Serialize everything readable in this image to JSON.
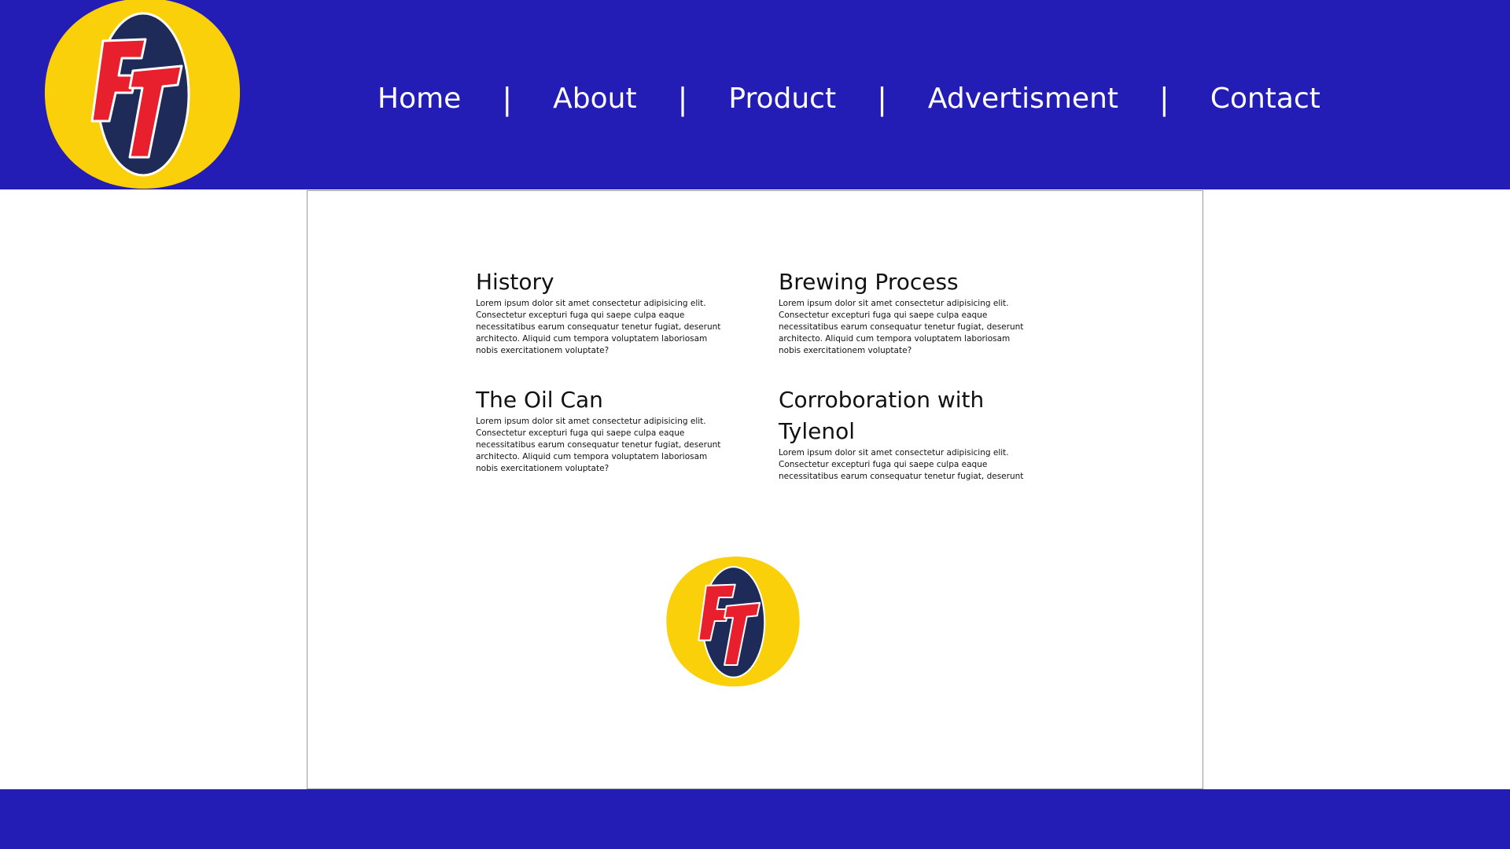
{
  "brand": {
    "logo_letters": "FT",
    "colors": {
      "header_blue": "#231db5",
      "logo_yellow": "#f9d009",
      "logo_navy": "#1e2a57",
      "logo_red": "#e8202e"
    }
  },
  "nav": {
    "items": [
      {
        "label": "Home"
      },
      {
        "label": "About"
      },
      {
        "label": "Product"
      },
      {
        "label": "Advertisment"
      },
      {
        "label": "Contact"
      }
    ],
    "separator": "|"
  },
  "sections": [
    {
      "title": "History",
      "body": "Lorem ipsum dolor sit amet consectetur adipisicing elit. Consectetur excepturi fuga qui saepe culpa eaque necessitatibus earum consequatur tenetur fugiat, deserunt architecto. Aliquid cum tempora voluptatem laboriosam nobis exercitationem voluptate?"
    },
    {
      "title": "Brewing Process",
      "body": "Lorem ipsum dolor sit amet consectetur adipisicing elit. Consectetur excepturi fuga qui saepe culpa eaque necessitatibus earum consequatur tenetur fugiat, deserunt architecto. Aliquid cum tempora voluptatem laboriosam nobis exercitationem voluptate?"
    },
    {
      "title": "The Oil Can",
      "body": "Lorem ipsum dolor sit amet consectetur adipisicing elit. Consectetur excepturi fuga qui saepe culpa eaque necessitatibus earum consequatur tenetur fugiat, deserunt architecto. Aliquid cum tempora voluptatem laboriosam nobis exercitationem voluptate?"
    },
    {
      "title": "Corroboration with Tylenol",
      "body": "Lorem ipsum dolor sit amet consectetur adipisicing elit. Consectetur excepturi fuga qui saepe culpa eaque necessitatibus earum consequatur tenetur fugiat, deserunt"
    }
  ]
}
